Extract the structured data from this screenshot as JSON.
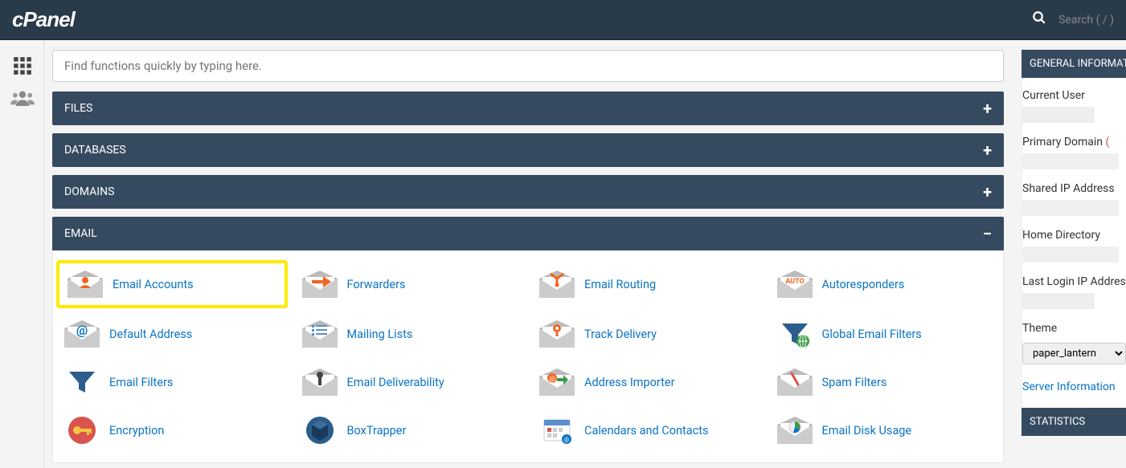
{
  "header": {
    "logo": "cPanel",
    "search_placeholder": "Search ( / )"
  },
  "search": {
    "placeholder": "Find functions quickly by typing here."
  },
  "sections": {
    "files": {
      "title": "FILES",
      "collapsed": true
    },
    "databases": {
      "title": "DATABASES",
      "collapsed": true
    },
    "domains": {
      "title": "DOMAINS",
      "collapsed": true
    },
    "email": {
      "title": "EMAIL",
      "collapsed": false,
      "items": [
        {
          "label": "Email Accounts",
          "highlighted": true
        },
        {
          "label": "Forwarders"
        },
        {
          "label": "Email Routing"
        },
        {
          "label": "Autoresponders"
        },
        {
          "label": "Default Address"
        },
        {
          "label": "Mailing Lists"
        },
        {
          "label": "Track Delivery"
        },
        {
          "label": "Global Email Filters"
        },
        {
          "label": "Email Filters"
        },
        {
          "label": "Email Deliverability"
        },
        {
          "label": "Address Importer"
        },
        {
          "label": "Spam Filters"
        },
        {
          "label": "Encryption"
        },
        {
          "label": "BoxTrapper"
        },
        {
          "label": "Calendars and Contacts"
        },
        {
          "label": "Email Disk Usage"
        }
      ]
    }
  },
  "sidebar": {
    "general_header": "GENERAL INFORMATION",
    "statistics_header": "STATISTICS",
    "info": {
      "current_user_label": "Current User",
      "primary_domain_label": "Primary Domain",
      "primary_domain_suffix": "(",
      "shared_ip_label": "Shared IP Address",
      "home_dir_label": "Home Directory",
      "last_login_label": "Last Login IP Address",
      "theme_label": "Theme",
      "theme_value": "paper_lantern",
      "server_info": "Server Information"
    }
  }
}
